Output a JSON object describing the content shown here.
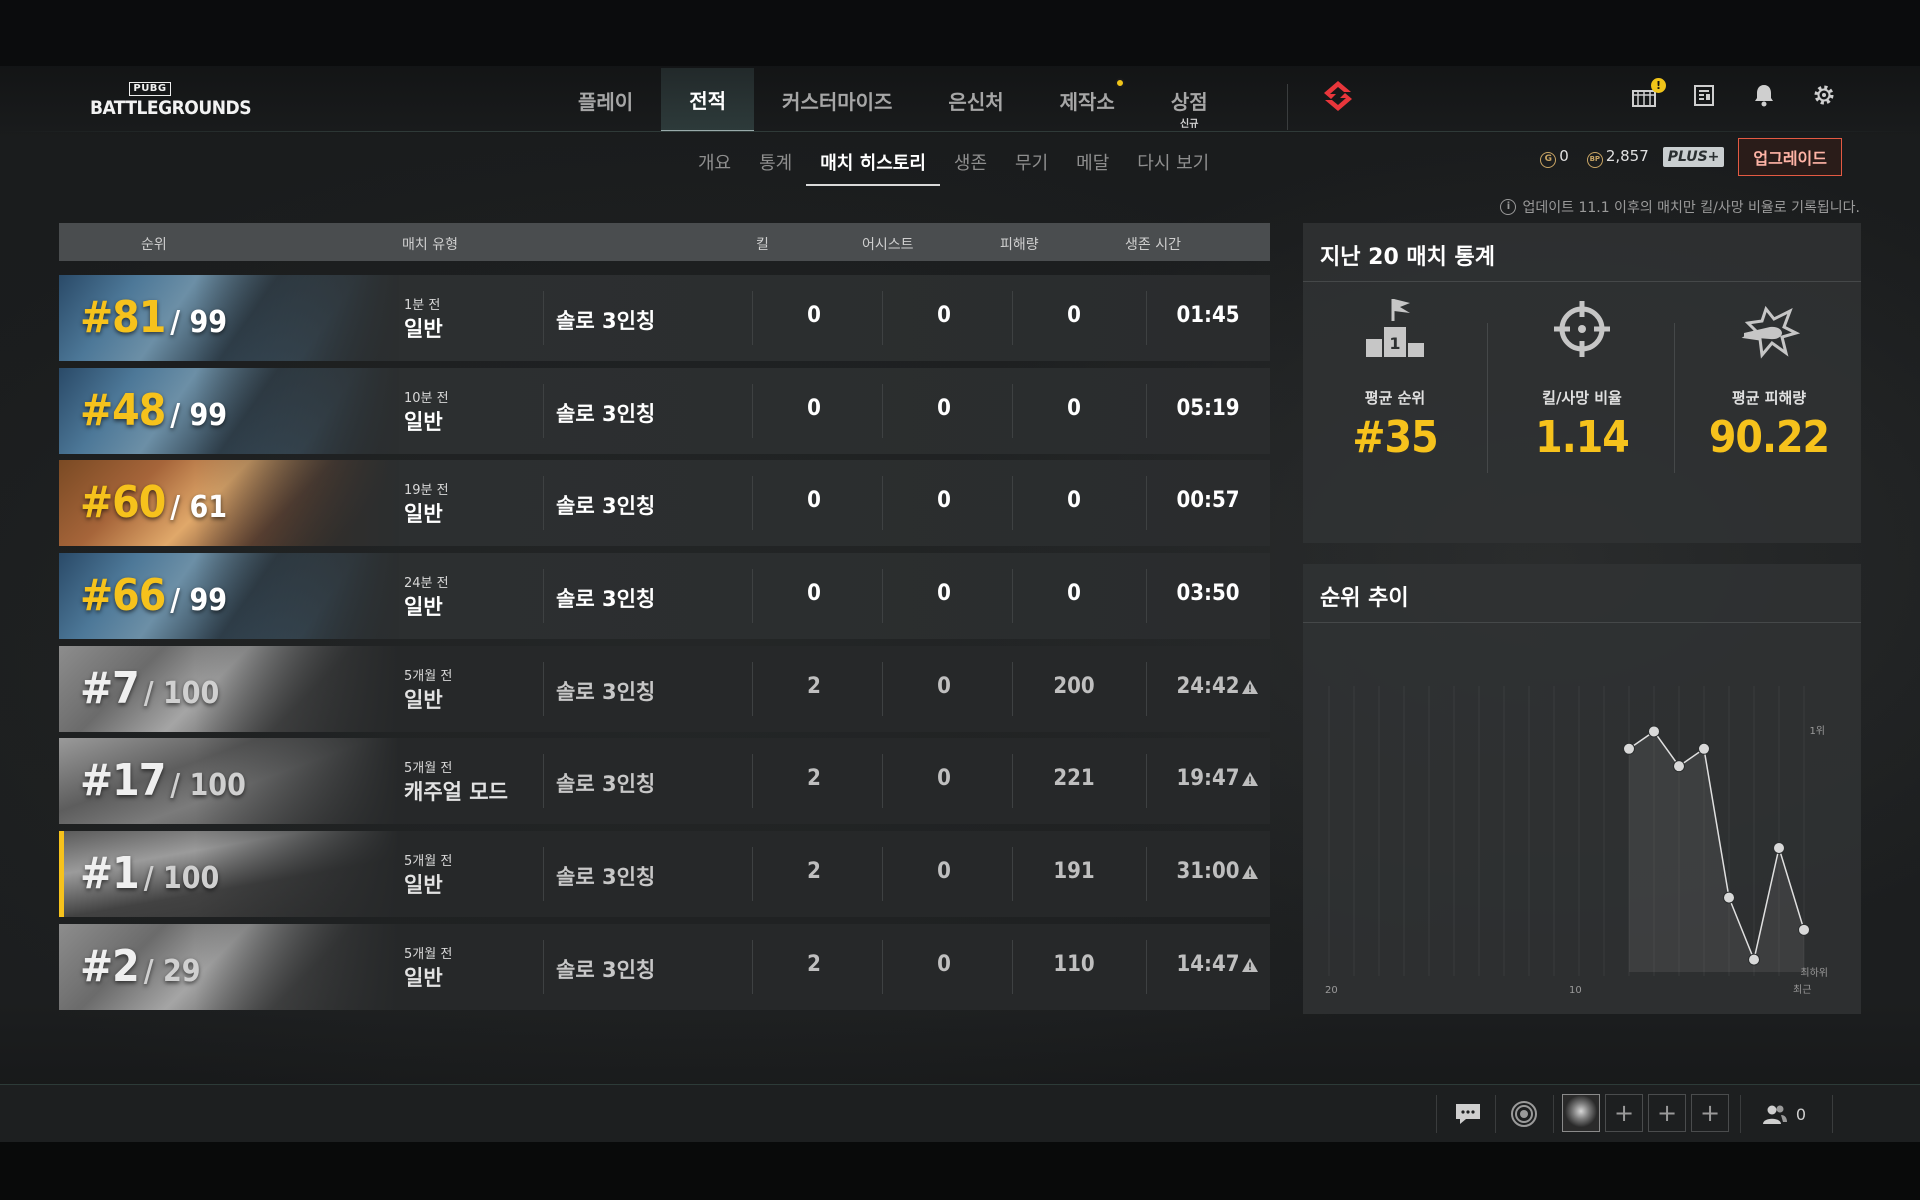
{
  "header": {
    "logo_top": "PUBG",
    "logo_main": "BATTLEGROUNDS",
    "tabs": [
      {
        "label": "플레이"
      },
      {
        "label": "전적"
      },
      {
        "label": "커스터마이즈"
      },
      {
        "label": "은신처"
      },
      {
        "label": "제작소"
      },
      {
        "label": "상점",
        "sub": "신규"
      }
    ]
  },
  "subnav": {
    "tabs": [
      "개요",
      "통계",
      "매치 히스토리",
      "생존",
      "무기",
      "메달",
      "다시 보기"
    ],
    "active": "매치 히스토리"
  },
  "currency": {
    "coin_label": "G",
    "coin_value": "0",
    "bp_label": "BP",
    "bp_value": "2,857",
    "plus_label": "PLUS+",
    "upgrade_label": "업그레이드"
  },
  "update_note": "업데이트 11.1 이후의 매치만 킬/사망 비율로 기록됩니다.",
  "table": {
    "headers": {
      "rank": "순위",
      "match_type": "매치 유형",
      "kills": "킬",
      "assists": "어시스트",
      "damage": "피해량",
      "survival": "생존 시간"
    },
    "rows": [
      {
        "rank": "#81",
        "total": "/ 99",
        "time_ago": "1분 전",
        "mode": "일반",
        "type": "솔로 3인칭",
        "kills": "0",
        "assists": "0",
        "damage": "0",
        "survival": "01:45"
      },
      {
        "rank": "#48",
        "total": "/ 99",
        "time_ago": "10분 전",
        "mode": "일반",
        "type": "솔로 3인칭",
        "kills": "0",
        "assists": "0",
        "damage": "0",
        "survival": "05:19"
      },
      {
        "rank": "#60",
        "total": "/ 61",
        "time_ago": "19분 전",
        "mode": "일반",
        "type": "솔로 3인칭",
        "kills": "0",
        "assists": "0",
        "damage": "0",
        "survival": "00:57"
      },
      {
        "rank": "#66",
        "total": "/ 99",
        "time_ago": "24분 전",
        "mode": "일반",
        "type": "솔로 3인칭",
        "kills": "0",
        "assists": "0",
        "damage": "0",
        "survival": "03:50"
      },
      {
        "rank": "#7",
        "total": "/ 100",
        "time_ago": "5개월 전",
        "mode": "일반",
        "type": "솔로 3인칭",
        "kills": "2",
        "assists": "0",
        "damage": "200",
        "survival": "24:42"
      },
      {
        "rank": "#17",
        "total": "/ 100",
        "time_ago": "5개월 전",
        "mode": "캐주얼 모드",
        "type": "솔로 3인칭",
        "kills": "2",
        "assists": "0",
        "damage": "221",
        "survival": "19:47"
      },
      {
        "rank": "#1",
        "total": "/ 100",
        "time_ago": "5개월 전",
        "mode": "일반",
        "type": "솔로 3인칭",
        "kills": "2",
        "assists": "0",
        "damage": "191",
        "survival": "31:00"
      },
      {
        "rank": "#2",
        "total": "/ 29",
        "time_ago": "5개월 전",
        "mode": "일반",
        "type": "솔로 3인칭",
        "kills": "2",
        "assists": "0",
        "damage": "110",
        "survival": "14:47"
      }
    ]
  },
  "summary": {
    "title": "지난 20 매치 통계",
    "items": [
      {
        "label": "평균 순위",
        "value": "#35",
        "icon": "podium-flag-icon"
      },
      {
        "label": "킬/사망 비율",
        "value": "1.14",
        "icon": "crosshair-icon"
      },
      {
        "label": "평균 피해량",
        "value": "90.22",
        "icon": "bullet-impact-icon"
      }
    ]
  },
  "trend": {
    "title": "순위 추이",
    "label_top": "1위",
    "label_bottom": "최하위",
    "axis_left": "20",
    "axis_mid": "10",
    "axis_right": "최근"
  },
  "chart_data": {
    "type": "line",
    "title": "순위 추이",
    "x": [
      13,
      14,
      15,
      16,
      17,
      18,
      19,
      20
    ],
    "values": [
      0.9,
      0.97,
      0.83,
      0.9,
      0.3,
      0.05,
      0.5,
      0.17
    ],
    "x_range": [
      1,
      20
    ],
    "y_range": [
      0,
      1
    ],
    "y_labels": [
      "최하위",
      "1위"
    ],
    "x_tick_labels": [
      "20",
      "10",
      "최근"
    ],
    "grid": true
  },
  "bottom": {
    "friends_count": "0"
  },
  "colors": {
    "accent": "#f6c21c",
    "upgrade": "#e45a43",
    "brand": "#e8363b"
  }
}
